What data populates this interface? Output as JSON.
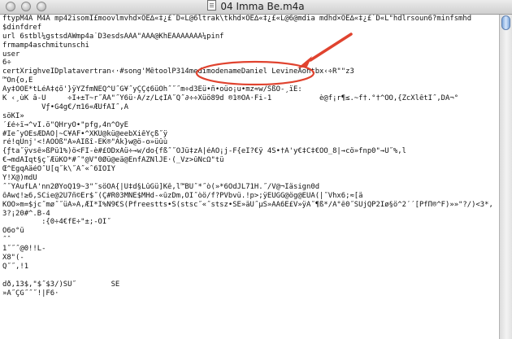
{
  "window": {
    "title": "04 Imma Be.m4a"
  },
  "content_lines": [
    "ftypM4A M4A mp42isomÎ£moovlmvhd×ÖE∆«‡¿£˙D«L@6ltrak\\tkhd×ÖE∆«‡¿£«L@6@mdia mdhd×ÖE∆«‡¿£˙D«L\"hdlrsoun6?minfsmhd",
    "$dinfdref",
    "url 6stbl¼gstsdÀWmp4a˙D3esdsÄÄÄ\"ÄÄÄ@KhÉÄÄÄÄÄÄÄ¼pinf",
    "frmamp4aschmitunschi",
    "user",
    "6÷",
    "certXrighveIDplatavertran‹·#song'MêtoolP314medimodenameDaniel LevineÄohtbx‹÷R\"\"z3",
    "™Õn{o,Ê",
    "Äy‡ÖOE*tLéÄ‡¢õ'}ÿŸZfmÑEQ^U˝G¥˝yÇÇ¢6üOh˝˝˝m÷d3Éü•ñ•oüo¡u•mz≈w/SßÕ-¸ïE:",
    "K ‹¸ùK â-Û     ÷I+±T~r˝ÅÄ\"˝Ÿ6ü·Ä/z/L¢IÄ˝Q˝∂÷÷Xüö89d ®1®ÕÀ·Fi-1           è@f¡r¶≤.~f†.°†^ÔÖ,{ZcXlêtI˝,DÄ¬°",
    "         Vƒ•G4g€/π16«ÆÜfÄI˝,Ä",
    "söKI»",
    "´£é÷ï→^vI.ö\"QHryÕ•\"pfg,4n^OyE",
    "#Ie˝yÖEsÆDAO|~C¥AF•^XKÜ@kü@eebXiêYçß˝ÿ",
    "ré!qUnj'<!ÃÖÖß\"Ä»ÄIßî-ÊK®\"Äk}w@ö-o»üûù",
    "{ƒta˝ÿvsê»ßPü1%)ö<FÌ-è#£ÖDxÄü÷→w/do{fß˝˝ÕJü‡zÀ|éÄÖ¡j-F{eI?€ÿ 4S•†A'y€‡C‡€ÖÕ_8|→cö»fnp0\"→Ü˝%,l",
    "€→mdÄIqt§ç˝ÆüKÖ*#˝\"@V\"0Øü@eä@EnfÄZÑlJÉ·(_Vz>ûNcΩ\"tü",
    "Œ^ÉgqÀäéÕ˝U[q˝k\\˝Ä˝«ˆ6IÖIY",
    "Y!X@)mdÜ",
    "˝˝YÄufLÄ'nn2ØYoQ19~3\"˝söOÄ{|Ü‡d§LûGü]Kê,l™BÜ˝*˝ò(»*6ÕdJL71H.˝/V@¬Iäsign0d",
    "ôÄw¢!≥6,SCie@2Ü7ñ©Er$˝(Ç#R03MNÉ$MHd-«ûzDm,ÕI˝òö/f?PVbvü.!p>;ÿEÜGG@ög@EÜÄ(|˝Vhx6;≈[ä",
    "KÖÕ»m=$jc˝mø˝˝üA»Ä,ÆI*Í%N9€S(Pfreestts•S(stsc˝«˝stsz•SE»äÜ˝µS»ÄÄ6Ê£V»ÿA˝¶ß*/Ä°ê0˝ŠÛjQP2Ïø§ö^2´´[PfΠ®^F)»»\"?/)<3*,",
    "3?¡20#^.B-4",
    "         :{0÷4€fÉ÷\"±;-ÕI˝",
    "Õ6o°ü",
    "˝ˆ",
    "1˝˝˝@0!!L-",
    "X8\"(-",
    "Q˝˝,!1",
    "",
    "dð,13$,\"$˝$3/)ŠÜ˝        SE",
    "»Ä˝ÇG˝˝˝!|F6·"
  ]
}
